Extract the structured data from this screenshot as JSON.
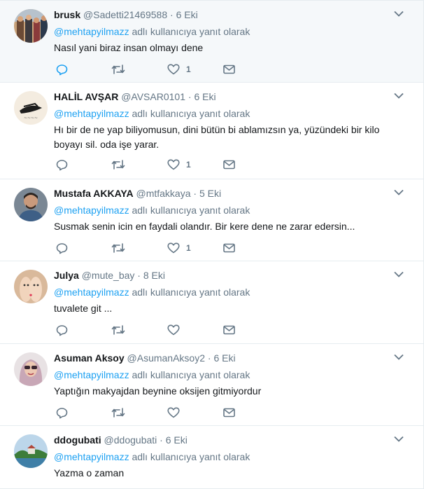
{
  "reply_prefix_suffix": "adlı kullanıcıya yanıt olarak",
  "colors": {
    "accent": "#1da1f2",
    "muted": "#657786",
    "text": "#14171a",
    "border": "#e6ecf0",
    "hover_bg": "#f5f8fa"
  },
  "icons": {
    "reply": "reply-icon",
    "retweet": "retweet-icon",
    "like": "heart-icon",
    "dm": "envelope-icon",
    "menu": "chevron-down-icon"
  },
  "tweets": [
    {
      "name": "brusk",
      "handle": "@Sadetti21469588",
      "time": "6 Eki",
      "reply_to": "@mehtapyilmazz",
      "text": "Nasıl yani biraz insan olmayı dene",
      "likes": "1"
    },
    {
      "name": "HALİL AVŞAR",
      "handle": "@AVSAR0101",
      "time": "6 Eki",
      "reply_to": "@mehtapyilmazz",
      "text": "Hı bir de ne yap biliyomusun, dini bütün bi ablamızsın ya, yüzündeki bir kilo boyayı sil. oda işe yarar.",
      "likes": "1"
    },
    {
      "name": "Mustafa AKKAYA",
      "handle": "@mtfakkaya",
      "time": "5 Eki",
      "reply_to": "@mehtapyilmazz",
      "text": "Susmak senin icin en faydali olandır. Bir kere dene ne zarar edersin...",
      "likes": "1"
    },
    {
      "name": "Julya",
      "handle": "@mute_bay",
      "time": "8 Eki",
      "reply_to": "@mehtapyilmazz",
      "text": "tuvalete git ...",
      "likes": ""
    },
    {
      "name": "Asuman Aksoy",
      "handle": "@AsumanAksoy2",
      "time": "6 Eki",
      "reply_to": "@mehtapyilmazz",
      "text": "Yaptığın makyajdan beynine oksijen gitmiyordur",
      "likes": ""
    },
    {
      "name": "ddogubati",
      "handle": "@ddogubati",
      "time": "6 Eki",
      "reply_to": "@mehtapyilmazz",
      "text": "Yazma o zaman",
      "likes": ""
    }
  ]
}
